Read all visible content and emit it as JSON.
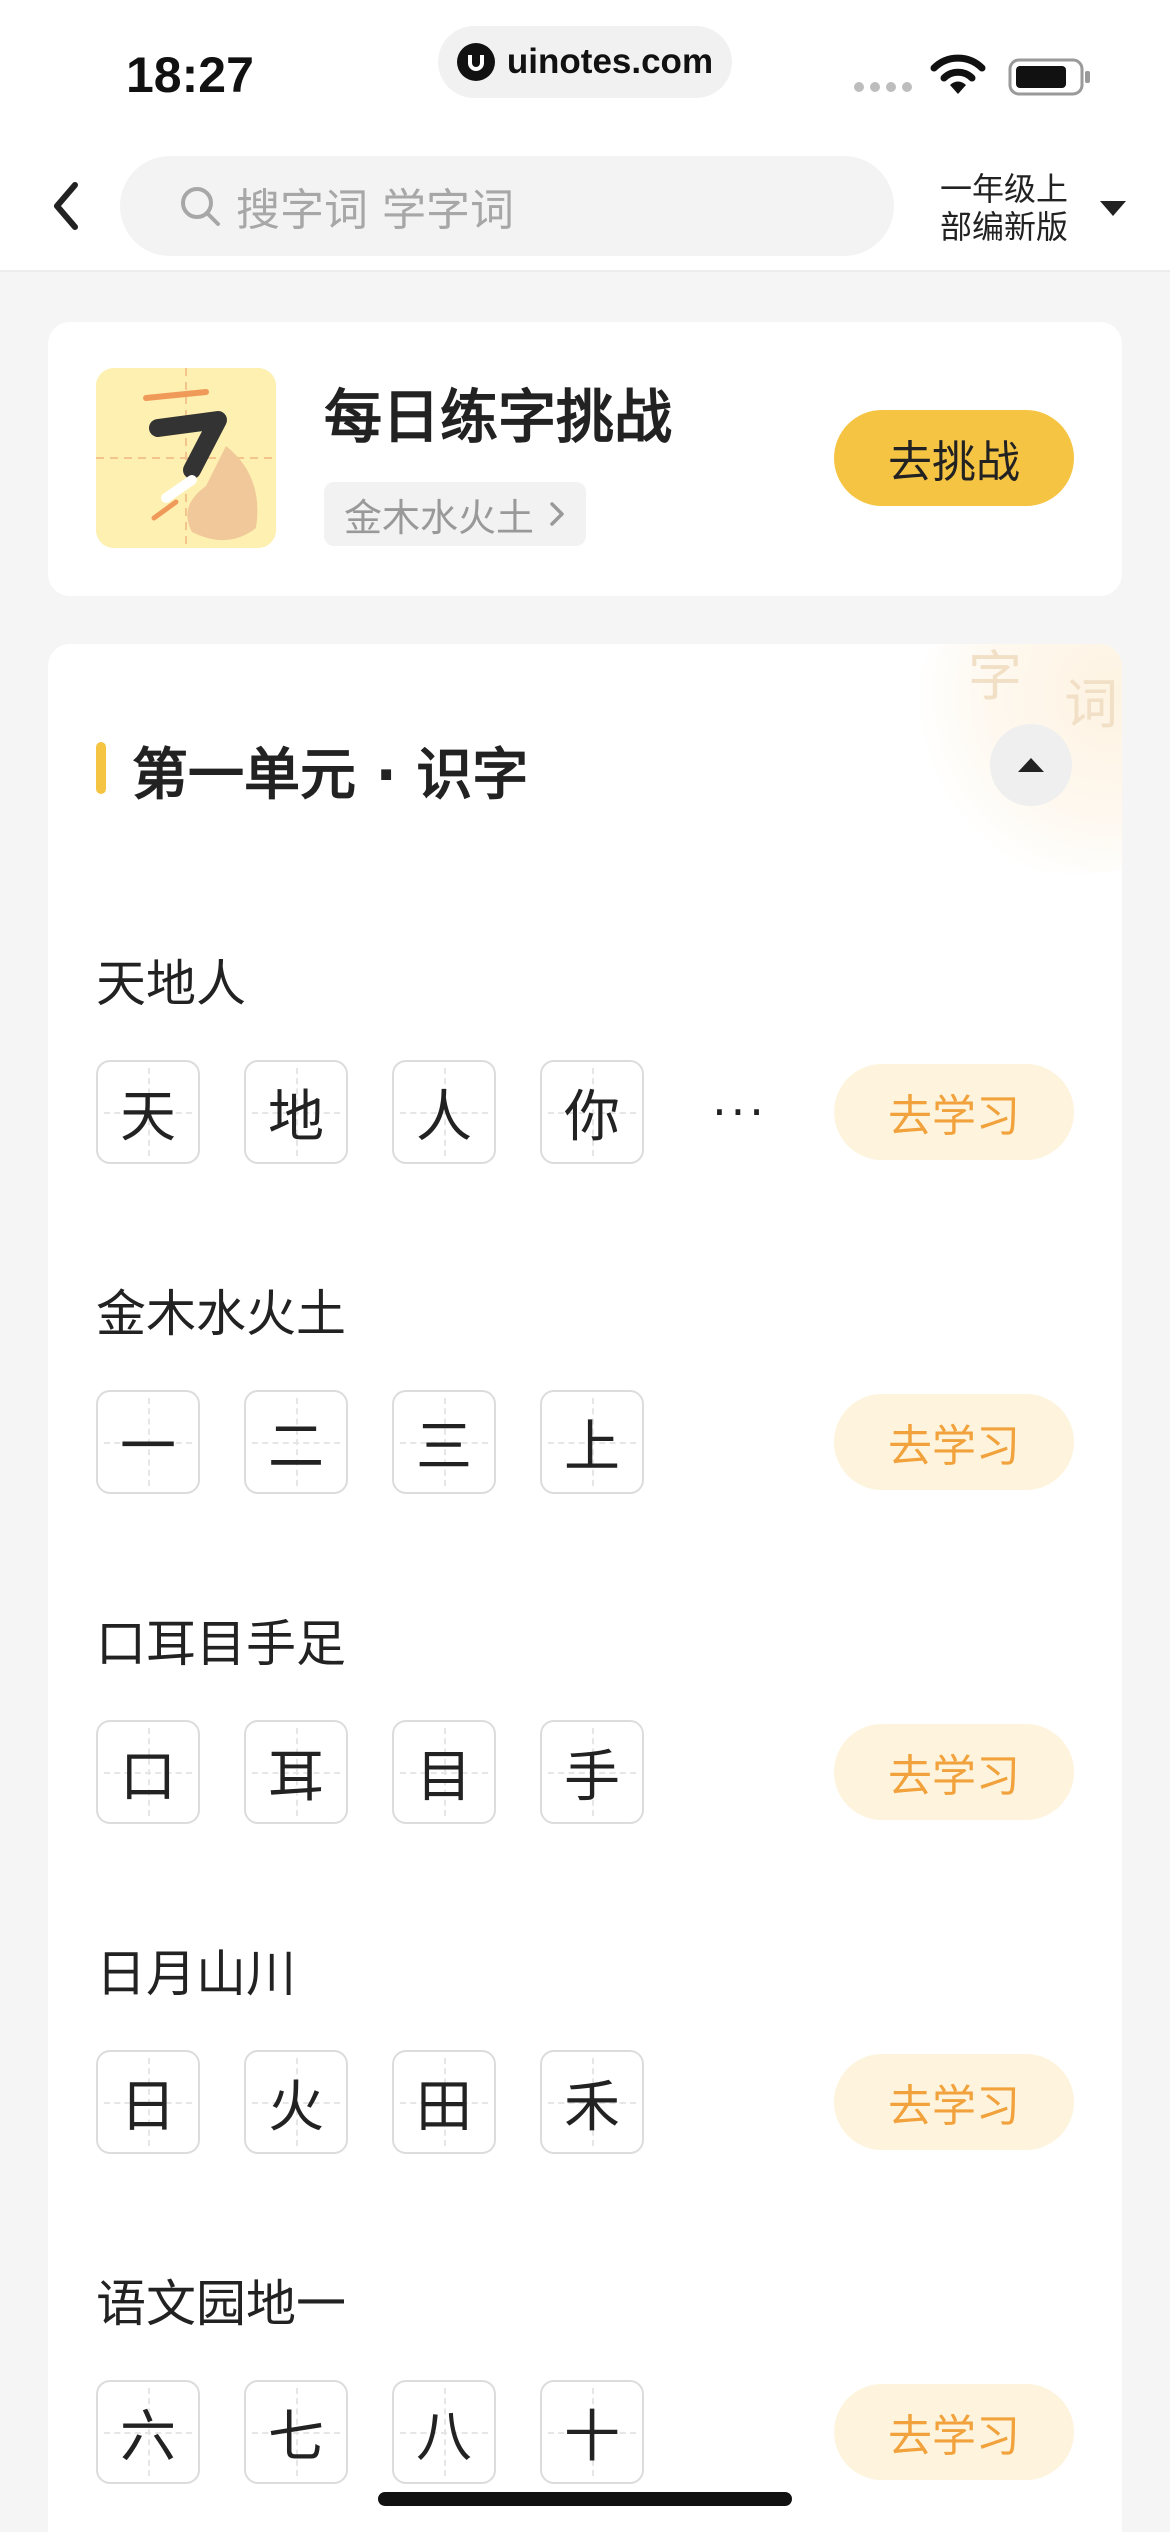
{
  "status_bar": {
    "time": "18:27",
    "url": "uinotes.com"
  },
  "header": {
    "search_placeholder": "搜字词 学字词",
    "grade_line1": "一年级上",
    "grade_line2": "部编新版"
  },
  "challenge": {
    "title": "每日练字挑战",
    "subtitle": "金木水火土",
    "button": "去挑战"
  },
  "unit": {
    "title": "第一单元 · 识字",
    "deco_chars": [
      "字",
      "词"
    ],
    "lessons": [
      {
        "title": "天地人",
        "chars": [
          "天",
          "地",
          "人",
          "你"
        ],
        "more": "···",
        "button": "去学习"
      },
      {
        "title": "金木水火土",
        "chars": [
          "一",
          "二",
          "三",
          "上"
        ],
        "button": "去学习"
      },
      {
        "title": "口耳目手足",
        "chars": [
          "口",
          "耳",
          "目",
          "手"
        ],
        "button": "去学习"
      },
      {
        "title": "日月山川",
        "chars": [
          "日",
          "火",
          "田",
          "禾"
        ],
        "button": "去学习"
      },
      {
        "title": "语文园地一",
        "chars": [
          "六",
          "七",
          "八",
          "十"
        ],
        "button": "去学习"
      }
    ]
  },
  "colors": {
    "accent": "#f6c443",
    "study_button_bg": "#fef4dd",
    "study_button_text": "#f1a23c",
    "page_bg": "#f5f5f6"
  }
}
